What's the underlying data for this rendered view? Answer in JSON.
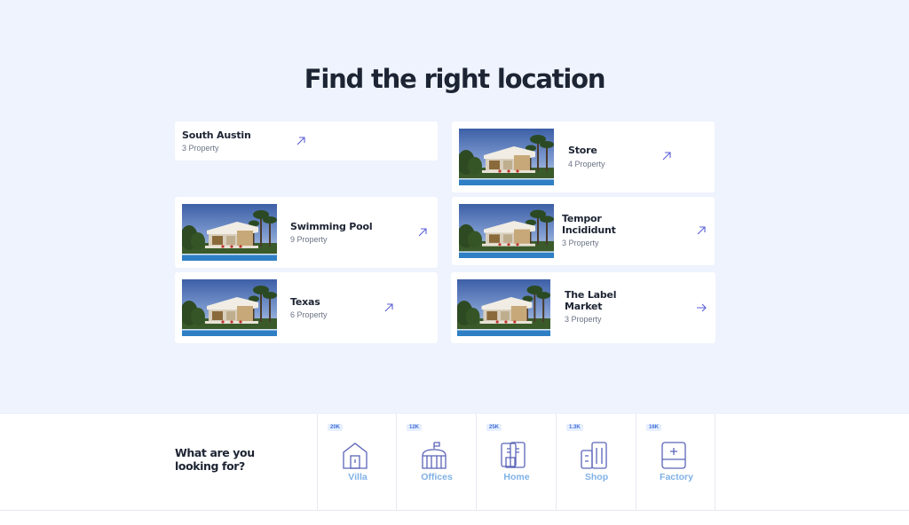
{
  "page": {
    "heading": "Find the right location"
  },
  "locations": [
    {
      "title": "South Austin",
      "count": "3 Property"
    },
    {
      "title": "Store",
      "count": "4 Property"
    },
    {
      "title": "Swimming Pool",
      "count": "9 Property"
    },
    {
      "title": "Tempor Incididunt",
      "count": "3 Property"
    },
    {
      "title": "Texas",
      "count": "6 Property"
    },
    {
      "title": "The Label Market",
      "count": "3 Property"
    }
  ],
  "search": {
    "question": "What are you looking for?",
    "categories": [
      {
        "label": "Villa",
        "badge": "20K",
        "icon": "villa-icon"
      },
      {
        "label": "Offices",
        "badge": "12K",
        "icon": "offices-icon"
      },
      {
        "label": "Home",
        "badge": "25K",
        "icon": "home-icon"
      },
      {
        "label": "Shop",
        "badge": "1.3K",
        "icon": "shop-icon"
      },
      {
        "label": "Factory",
        "badge": "16K",
        "icon": "factory-icon"
      }
    ]
  },
  "colors": {
    "hero_background": "#eef3fd",
    "accent": "#5a5fd6",
    "category_label": "#7fb1e6",
    "icon_stroke": "#5b63b8"
  }
}
